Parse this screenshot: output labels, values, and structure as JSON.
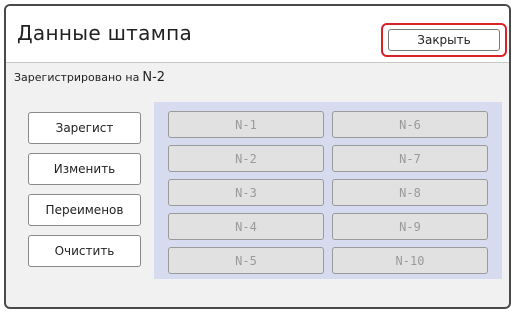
{
  "window": {
    "title": "Данные штампа",
    "close_label": "Закрыть"
  },
  "registration": {
    "label": "Зарегистрировано на",
    "value": "N-2"
  },
  "actions": [
    {
      "label": "Зарегист"
    },
    {
      "label": "Изменить"
    },
    {
      "label": "Переименов"
    },
    {
      "label": "Очистить"
    }
  ],
  "slots": [
    {
      "label": "N-1"
    },
    {
      "label": "N-6"
    },
    {
      "label": "N-2"
    },
    {
      "label": "N-7"
    },
    {
      "label": "N-3"
    },
    {
      "label": "N-8"
    },
    {
      "label": "N-4"
    },
    {
      "label": "N-9"
    },
    {
      "label": "N-5"
    },
    {
      "label": "N-10"
    }
  ],
  "colors": {
    "highlight_border": "#d9232a",
    "slot_panel_bg": "#d7dbef",
    "slot_text_disabled": "#9a9a9a"
  }
}
